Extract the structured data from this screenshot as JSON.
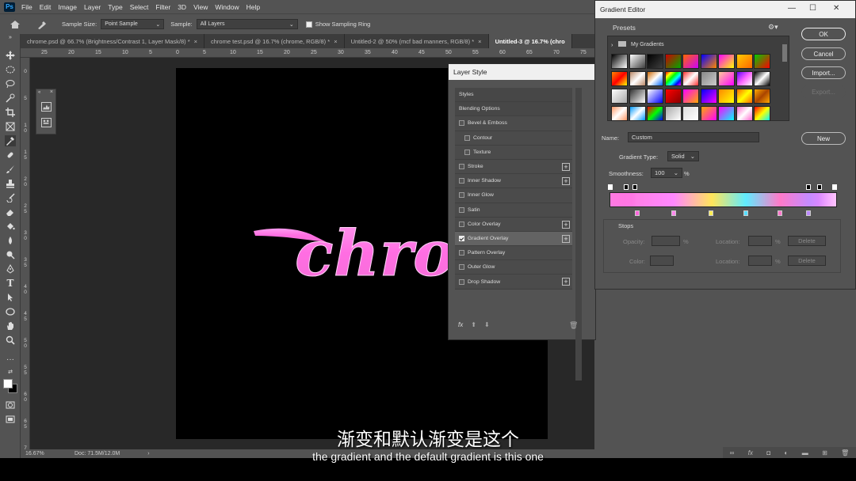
{
  "menu": {
    "items": [
      "File",
      "Edit",
      "Image",
      "Layer",
      "Type",
      "Select",
      "Filter",
      "3D",
      "View",
      "Window",
      "Help"
    ]
  },
  "options": {
    "sample_size_label": "Sample Size:",
    "sample_size_value": "Point Sample",
    "sample_label": "Sample:",
    "sample_value": "All Layers",
    "sampling_ring_label": "Show Sampling Ring"
  },
  "tabs": [
    "chrome.psd @ 66.7% (Brightness/Contrast 1, Layer Mask/8) *",
    "chrome test.psd @ 16.7% (chrome, RGB/8) *",
    "Untitled-2 @ 50% (mcf bad manners, RGB/8) *",
    "Untitled-3 @ 16.7% (chro"
  ],
  "ruler": {
    "top": [
      "25",
      "20",
      "15",
      "10",
      "5",
      "0",
      "5",
      "10",
      "15",
      "20",
      "25",
      "30",
      "35",
      "40",
      "45",
      "50",
      "55",
      "60",
      "65",
      "70",
      "75"
    ],
    "left": [
      "0",
      "5",
      "1 0",
      "1 5",
      "2 0",
      "2 5",
      "3 0",
      "3 5",
      "4 0",
      "4 5",
      "5 0",
      "5 5",
      "6 0",
      "6 5",
      "7"
    ]
  },
  "canvas_text": "chrome",
  "status": {
    "zoom": "16.67%",
    "doc": "Doc: 71.5M/12.0M"
  },
  "layer_style": {
    "title": "Layer Style",
    "rows": [
      {
        "label": "Styles",
        "kind": "header"
      },
      {
        "label": "Blending Options",
        "kind": "header"
      },
      {
        "label": "Bevel & Emboss",
        "kind": "check",
        "checked": false
      },
      {
        "label": "Contour",
        "kind": "sub",
        "checked": false
      },
      {
        "label": "Texture",
        "kind": "sub",
        "checked": false
      },
      {
        "label": "Stroke",
        "kind": "check",
        "checked": false,
        "plus": true
      },
      {
        "label": "Inner Shadow",
        "kind": "check",
        "checked": false,
        "plus": true
      },
      {
        "label": "Inner Glow",
        "kind": "check",
        "checked": false
      },
      {
        "label": "Satin",
        "kind": "check",
        "checked": false
      },
      {
        "label": "Color Overlay",
        "kind": "check",
        "checked": false,
        "plus": true
      },
      {
        "label": "Gradient Overlay",
        "kind": "check",
        "checked": true,
        "plus": true,
        "selected": true
      },
      {
        "label": "Pattern Overlay",
        "kind": "check",
        "checked": false
      },
      {
        "label": "Outer Glow",
        "kind": "check",
        "checked": false
      },
      {
        "label": "Drop Shadow",
        "kind": "check",
        "checked": false,
        "plus": true
      }
    ],
    "fx_label": "fx"
  },
  "gradient_editor": {
    "title": "Gradient Editor",
    "presets_label": "Presets",
    "folder_label": "My Gradients",
    "buttons": {
      "ok": "OK",
      "cancel": "Cancel",
      "import": "Import...",
      "export": "Export...",
      "new": "New"
    },
    "name_label": "Name:",
    "name_value": "Custom",
    "gradient_type_label": "Gradient Type:",
    "gradient_type_value": "Solid",
    "smoothness_label": "Smoothness:",
    "smoothness_value": "100",
    "smoothness_unit": "%",
    "stops_label": "Stops",
    "opacity_label": "Opacity:",
    "location_label": "Location:",
    "color_label": "Color:",
    "delete_label": "Delete",
    "percent": "%",
    "color_stops": [
      "#ff66dd",
      "#ff88ee",
      "#ffee55",
      "#55ddff",
      "#ff77cc",
      "#bb88ff"
    ]
  },
  "subtitles": {
    "cn": "渐变和默认渐变是这个",
    "en": "the gradient and the default gradient is this one"
  },
  "colors": {
    "panel": "#535353",
    "workspace": "#282828",
    "accent_pink": "#ff4fd8"
  }
}
